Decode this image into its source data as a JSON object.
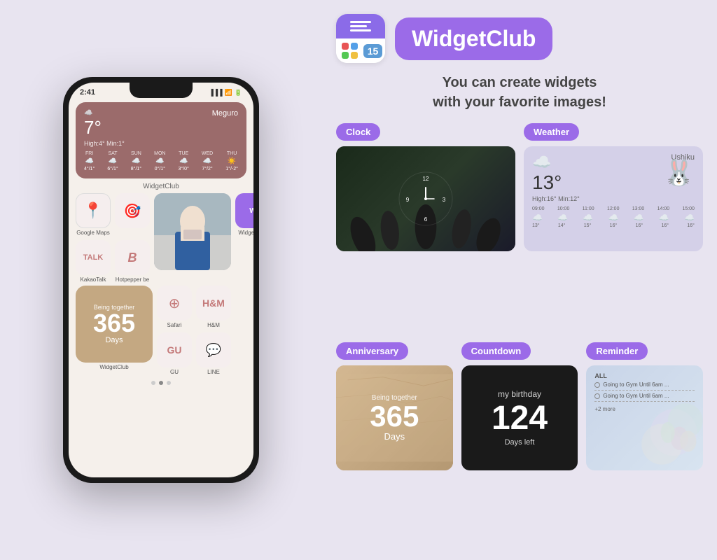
{
  "phone": {
    "time": "2:41",
    "weather_widget": {
      "temp": "7°",
      "location": "Meguro",
      "high_low": "High:4° Min:1°",
      "days": [
        "FRI",
        "SAT",
        "SUN",
        "MON",
        "TUE",
        "WED",
        "THU"
      ],
      "temps": [
        "4°/1°",
        "6°/1°",
        "8°/1°",
        "0°/1°",
        "3°/0°",
        "7°/2°",
        "1°/-2°"
      ]
    },
    "widget_label": "WidgetClub",
    "apps": {
      "google_maps": "Google Maps",
      "kakao_talk": "KakaoTalk",
      "hotpepper": "Hotpepper be",
      "widget_club": "WidgetClub",
      "safari": "Safari",
      "hm": "H&M",
      "gu": "GU",
      "line": "LINE"
    },
    "anniversary": {
      "label": "Being together",
      "number": "365",
      "unit": "Days"
    }
  },
  "app": {
    "name": "WidgetClub",
    "tagline_line1": "You can create widgets",
    "tagline_line2": "with your favorite images!"
  },
  "widgets": {
    "clock_label": "Clock",
    "weather_label": "Weather",
    "anniversary_label": "Anniversary",
    "countdown_label": "Countdown",
    "reminder_label": "Reminder",
    "clock_num_12": "12",
    "clock_num_3": "3",
    "clock_num_6": "6",
    "clock_num_9": "9",
    "weather_preview": {
      "temp": "13°",
      "location": "Ushiku",
      "high_low": "High:16° Min:12°",
      "times": [
        "09:00",
        "10:00",
        "11:00",
        "12:00",
        "13:00",
        "14:00",
        "15:00"
      ],
      "temps_row": [
        "13°",
        "14°",
        "15°",
        "16°",
        "16°",
        "16°",
        "16°"
      ]
    },
    "anniversary_preview": {
      "label": "Being together",
      "number": "365",
      "unit": "Days"
    },
    "countdown_preview": {
      "label": "my birthday",
      "number": "124",
      "unit": "Days left"
    },
    "reminder_preview": {
      "all_label": "ALL",
      "items": [
        "Going to Gym Until 6am ...",
        "Going to Gym Until 6am ...",
        "+2 more"
      ]
    }
  }
}
